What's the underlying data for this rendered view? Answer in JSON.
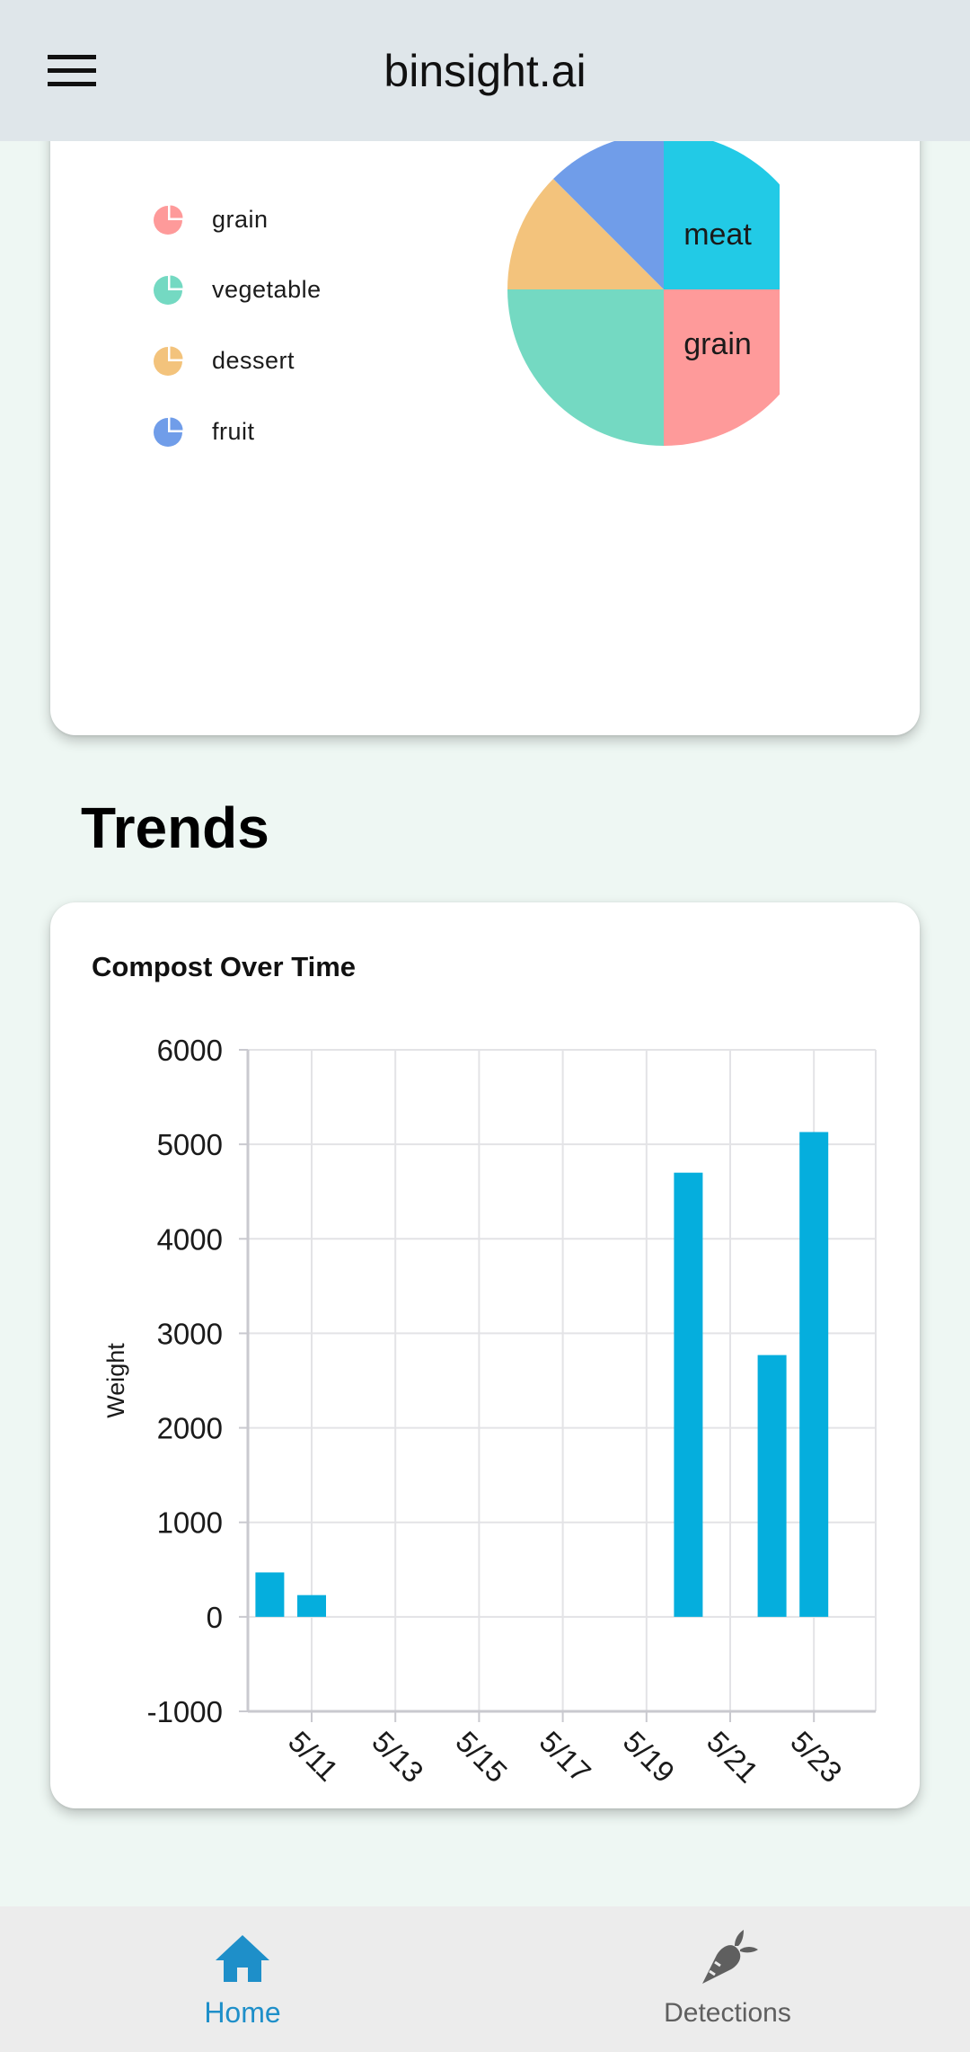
{
  "app_bar": {
    "title": "binsight.ai"
  },
  "breakdown": {
    "legend": [
      {
        "label": "grain",
        "color": "#fe9a9a"
      },
      {
        "label": "vegetable",
        "color": "#74d9c2"
      },
      {
        "label": "dessert",
        "color": "#f3c37c"
      },
      {
        "label": "fruit",
        "color": "#709de9"
      }
    ],
    "slice_labels": {
      "meat": "meat",
      "grain": "grain"
    },
    "colors": {
      "meat": "#22cae6",
      "grain": "#fe9a9a",
      "vegetable": "#74d9c2",
      "dessert": "#f3c37c",
      "fruit": "#709de9"
    }
  },
  "trends": {
    "section_title": "Trends",
    "chart_title": "Compost Over Time"
  },
  "chart_data": {
    "type": "bar",
    "title": "Compost Over Time",
    "xlabel": "",
    "ylabel": "Weight",
    "ylim": [
      -1000,
      6000
    ],
    "yticks": [
      6000,
      5000,
      4000,
      3000,
      2000,
      1000,
      0,
      -1000
    ],
    "x_tick_labels": [
      "5/11",
      "5/13",
      "5/15",
      "5/17",
      "5/19",
      "5/21",
      "5/23"
    ],
    "x": [
      "5/10",
      "5/11",
      "5/20",
      "5/22",
      "5/23"
    ],
    "values": [
      470,
      230,
      4700,
      2770,
      5130
    ],
    "bar_color": "#05aedd",
    "grid": true
  },
  "bottom_nav": {
    "home_label": "Home",
    "detections_label": "Detections",
    "active_color": "#1e8fc9",
    "inactive_color": "#5f5f5f"
  }
}
